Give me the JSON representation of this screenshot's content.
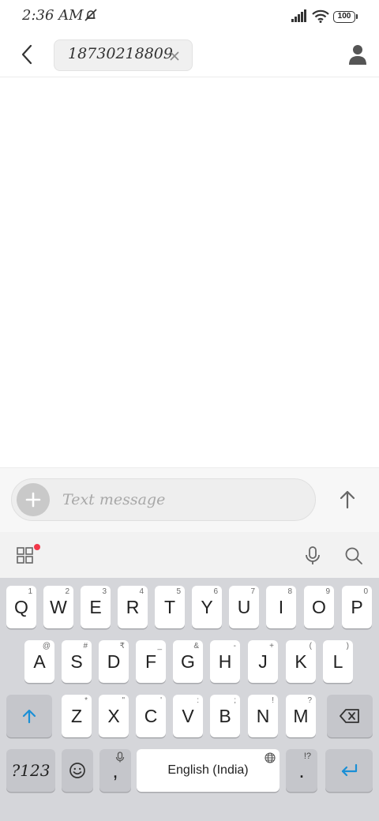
{
  "status_bar": {
    "time": "2:36 AM",
    "battery": "100",
    "icons": [
      "dnd-off-icon",
      "signal-icon",
      "wifi-icon",
      "battery-icon"
    ]
  },
  "header": {
    "recipient_number": "18730218809",
    "icons": [
      "back-arrow-icon",
      "close-icon",
      "contact-icon"
    ]
  },
  "compose": {
    "placeholder": "Text message",
    "icons": [
      "plus-icon",
      "send-arrow-icon"
    ]
  },
  "keyboard_toolbar": {
    "icons": [
      "apps-grid-icon",
      "microphone-icon",
      "search-icon"
    ]
  },
  "keyboard": {
    "row1": [
      {
        "label": "Q",
        "hint": "1"
      },
      {
        "label": "W",
        "hint": "2"
      },
      {
        "label": "E",
        "hint": "3"
      },
      {
        "label": "R",
        "hint": "4"
      },
      {
        "label": "T",
        "hint": "5"
      },
      {
        "label": "Y",
        "hint": "6"
      },
      {
        "label": "U",
        "hint": "7"
      },
      {
        "label": "I",
        "hint": "8"
      },
      {
        "label": "O",
        "hint": "9"
      },
      {
        "label": "P",
        "hint": "0"
      }
    ],
    "row2": [
      {
        "label": "A",
        "hint": "@"
      },
      {
        "label": "S",
        "hint": "#"
      },
      {
        "label": "D",
        "hint": "₹"
      },
      {
        "label": "F",
        "hint": "_"
      },
      {
        "label": "G",
        "hint": "&"
      },
      {
        "label": "H",
        "hint": "-"
      },
      {
        "label": "J",
        "hint": "+"
      },
      {
        "label": "K",
        "hint": "("
      },
      {
        "label": "L",
        "hint": ")"
      }
    ],
    "row3": [
      {
        "label": "Z",
        "hint": "*"
      },
      {
        "label": "X",
        "hint": "\""
      },
      {
        "label": "C",
        "hint": "'"
      },
      {
        "label": "V",
        "hint": ":"
      },
      {
        "label": "B",
        "hint": ";"
      },
      {
        "label": "N",
        "hint": "!"
      },
      {
        "label": "M",
        "hint": "?"
      }
    ],
    "symbols_label": "?123",
    "comma_label": ",",
    "space_label": "English (India)",
    "period_label": ".",
    "period_hint": "!?",
    "icons": [
      "shift-icon",
      "backspace-icon",
      "emoji-icon",
      "globe-icon",
      "enter-icon"
    ]
  },
  "colors": {
    "accent": "#1a8fd6",
    "notification_dot": "#f2384a"
  }
}
